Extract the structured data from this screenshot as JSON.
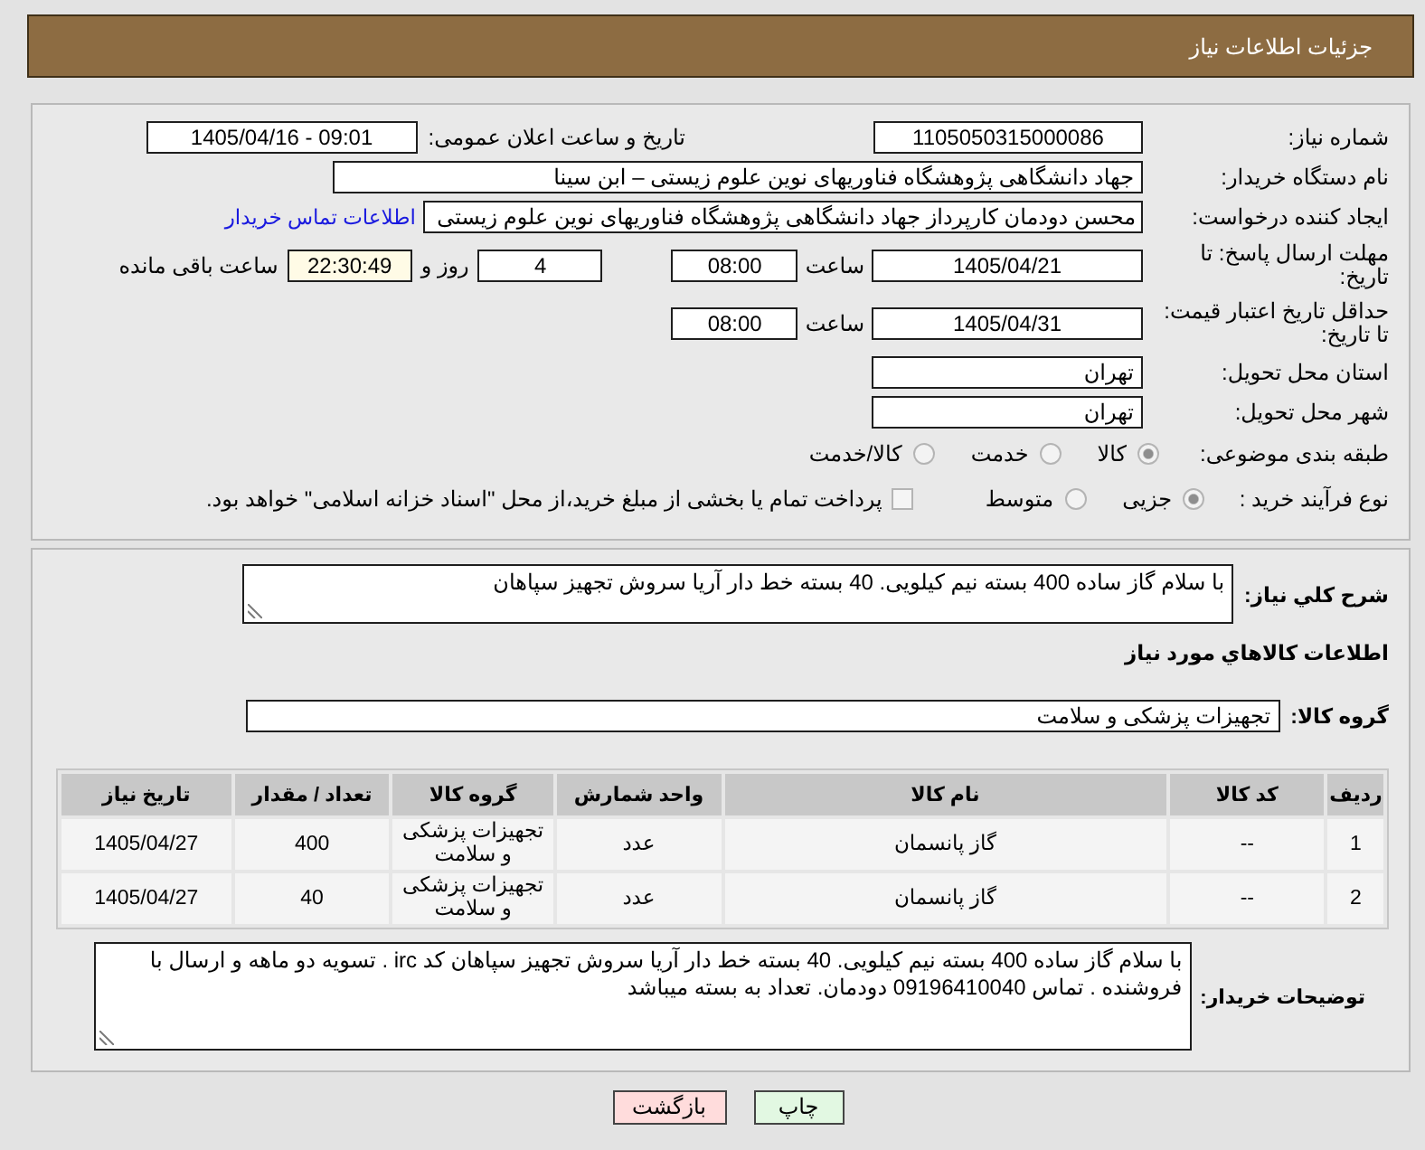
{
  "header": {
    "title": "جزئیات اطلاعات نیاز"
  },
  "need_number": {
    "label": "شماره نیاز:",
    "value": "1105050315000086"
  },
  "announce": {
    "label": "تاریخ و ساعت اعلان عمومی:",
    "value": "1405/04/16 - 09:01"
  },
  "buyer_org": {
    "label": "نام دستگاه خریدار:",
    "value": "جهاد دانشگاهی پژوهشگاه فناوریهای نوین علوم زیستی – ابن سینا"
  },
  "requester": {
    "label": "ایجاد کننده درخواست:",
    "value": "محسن دودمان کارپرداز جهاد دانشگاهی پژوهشگاه فناوریهای نوین علوم زیستی",
    "contact_link": "اطلاعات تماس خریدار"
  },
  "response_deadline": {
    "label": "مهلت ارسال پاسخ: تا تاریخ:",
    "date": "1405/04/21",
    "time_label": "ساعت",
    "time": "08:00",
    "days": "4",
    "days_label": "روز و",
    "remaining": "22:30:49",
    "remaining_label": "ساعت باقی مانده"
  },
  "price_validity": {
    "label": "حداقل تاریخ اعتبار قیمت: تا تاریخ:",
    "date": "1405/04/31",
    "time_label": "ساعت",
    "time": "08:00"
  },
  "delivery_province": {
    "label": "استان محل تحویل:",
    "value": "تهران"
  },
  "delivery_city": {
    "label": "شهر محل تحویل:",
    "value": "تهران"
  },
  "category": {
    "label": "طبقه بندی موضوعی:",
    "options": [
      {
        "label": "کالا",
        "selected": true
      },
      {
        "label": "خدمت",
        "selected": false
      },
      {
        "label": "کالا/خدمت",
        "selected": false
      }
    ]
  },
  "purchase_process": {
    "label": "نوع فرآیند خرید :",
    "options": [
      {
        "label": "جزیی",
        "selected": true
      },
      {
        "label": "متوسط",
        "selected": false
      }
    ],
    "treasury": {
      "label": "پرداخت تمام یا بخشی از مبلغ خرید،از محل \"اسناد خزانه اسلامی\" خواهد بود.",
      "checked": false
    }
  },
  "description": {
    "label": "شرح کلي نیاز:",
    "value": "با سلام گاز ساده 400 بسته نیم کیلویی. 40 بسته خط دار آریا سروش تجهیز سپاهان"
  },
  "goods_section": {
    "title": "اطلاعات کالاهاي مورد نیاز"
  },
  "goods_group": {
    "label": "گروه کالا:",
    "value": "تجهیزات پزشکی و سلامت"
  },
  "table": {
    "columns": [
      "ردیف",
      "کد کالا",
      "نام کالا",
      "واحد شمارش",
      "گروه کالا",
      "تعداد / مقدار",
      "تاریخ نیاز"
    ],
    "rows": [
      [
        "1",
        "--",
        "گاز پانسمان",
        "عدد",
        "تجهیزات پزشکی و سلامت",
        "400",
        "1405/04/27"
      ],
      [
        "2",
        "--",
        "گاز پانسمان",
        "عدد",
        "تجهیزات پزشکی و سلامت",
        "40",
        "1405/04/27"
      ]
    ]
  },
  "buyer_notes": {
    "label": "توضیحات خریدار:",
    "value": "با سلام گاز ساده 400 بسته نیم کیلویی. 40 بسته خط دار آریا سروش تجهیز سپاهان کد irc . تسویه دو ماهه و ارسال با فروشنده . تماس 09196410040 دودمان. تعداد به بسته میباشد"
  },
  "buttons": [
    {
      "label": "چاپ",
      "kind": "print"
    },
    {
      "label": "بازگشت",
      "kind": "back"
    }
  ]
}
